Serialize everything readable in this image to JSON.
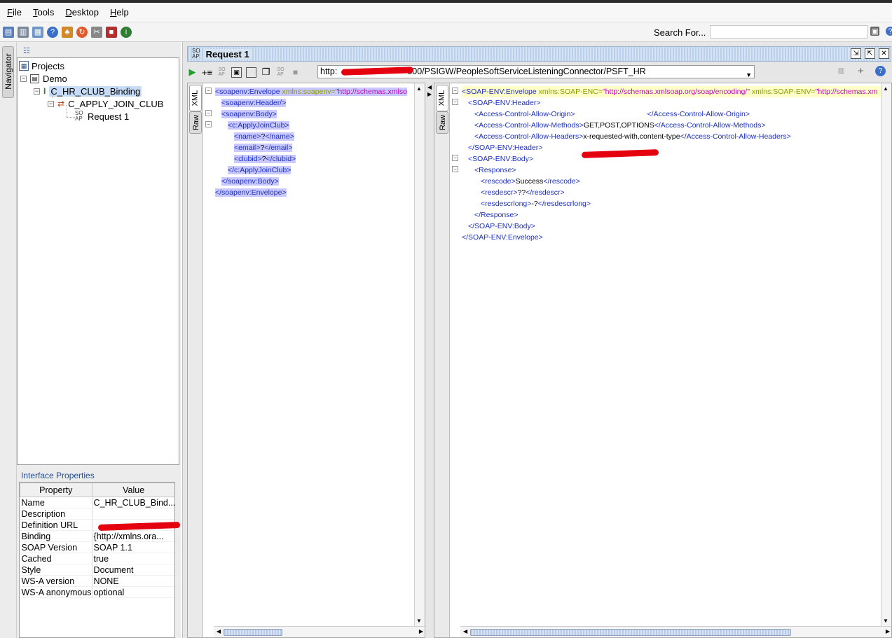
{
  "menu": [
    "File",
    "Tools",
    "Desktop",
    "Help"
  ],
  "search": {
    "label": "Search For...",
    "value": ""
  },
  "navigator": {
    "tab_label": "Navigator"
  },
  "tree": {
    "root": "Projects",
    "project": "Demo",
    "binding": "C_HR_CLUB_Binding",
    "operation": "C_APPLY_JOIN_CLUB",
    "request": "Request 1"
  },
  "interface_properties": {
    "title": "Interface Properties",
    "columns": [
      "Property",
      "Value"
    ],
    "rows": [
      {
        "property": "Name",
        "value": "C_HR_CLUB_Bind..."
      },
      {
        "property": "Description",
        "value": ""
      },
      {
        "property": "Definition URL",
        "value": ""
      },
      {
        "property": "Binding",
        "value": "{http://xmlns.ora..."
      },
      {
        "property": "SOAP Version",
        "value": "SOAP 1.1"
      },
      {
        "property": "Cached",
        "value": "true"
      },
      {
        "property": "Style",
        "value": "Document"
      },
      {
        "property": "WS-A version",
        "value": "NONE"
      },
      {
        "property": "WS-A anonymous",
        "value": "optional"
      }
    ]
  },
  "request": {
    "title": "Request 1",
    "endpoint_prefix": "http:",
    "endpoint_suffix": "800/PSIGW/PeopleSoftServiceListeningConnector/PSFT_HR"
  },
  "tabs": {
    "xml": "XML",
    "raw": "Raw"
  },
  "request_xml": {
    "l1_tag": "<soapenv:Envelope ",
    "l1_attr": "xmlns:soapenv=",
    "l1_str": "\"http://schemas.xmlso",
    "l2": "<soapenv:Header/>",
    "l3": "<soapenv:Body>",
    "l4": "<c:ApplyJoinClub>",
    "l5_open": "<name>",
    "l5_val": "?",
    "l5_close": "</name>",
    "l6_open": "<email>",
    "l6_val": "?",
    "l6_close": "</email>",
    "l7_open": "<clubid>",
    "l7_val": "?",
    "l7_close": "</clubid>",
    "l8": "</c:ApplyJoinClub>",
    "l9": "</soapenv:Body>",
    "l10": "</soapenv:Envelope>"
  },
  "response_xml": {
    "l1_tag": "<SOAP-ENV:Envelope ",
    "l1_attr1": "xmlns:SOAP-ENC=",
    "l1_str1": "\"http://schemas.xmlsoap.org/soap/encoding/\"",
    "l1_attr2": " xmlns:SOAP-ENV=",
    "l1_str2": "\"http://schemas.xm",
    "l2": "<SOAP-ENV:Header>",
    "l3_open": "<Access-Control-Allow-Origin>",
    "l3_close": "</Access-Control-Allow-Origin>",
    "l4_open": "<Access-Control-Allow-Methods>",
    "l4_val": "GET,POST,OPTIONS",
    "l4_close": "</Access-Control-Allow-Methods>",
    "l5_open": "<Access-Control-Allow-Headers>",
    "l5_val": "x-requested-with,content-type",
    "l5_close": "</Access-Control-Allow-Headers>",
    "l6": "</SOAP-ENV:Header>",
    "l7": "<SOAP-ENV:Body>",
    "l8": "<Response>",
    "l9_open": "<rescode>",
    "l9_val": "Success",
    "l9_close": "</rescode>",
    "l10_open": "<resdescr>",
    "l10_val": "??",
    "l10_close": "</resdescr>",
    "l11_open": "<resdescrlong>",
    "l11_val": "-?",
    "l11_close": "</resdescrlong>",
    "l12": "</Response>",
    "l13": "</SOAP-ENV:Body>",
    "l14": "</SOAP-ENV:Envelope>"
  },
  "colors": {
    "tag": "#1a2ec4",
    "attribute": "#8a9a00",
    "string": "#c000c0",
    "selection": "#c6dcf7",
    "redaction": "#e4000f"
  }
}
